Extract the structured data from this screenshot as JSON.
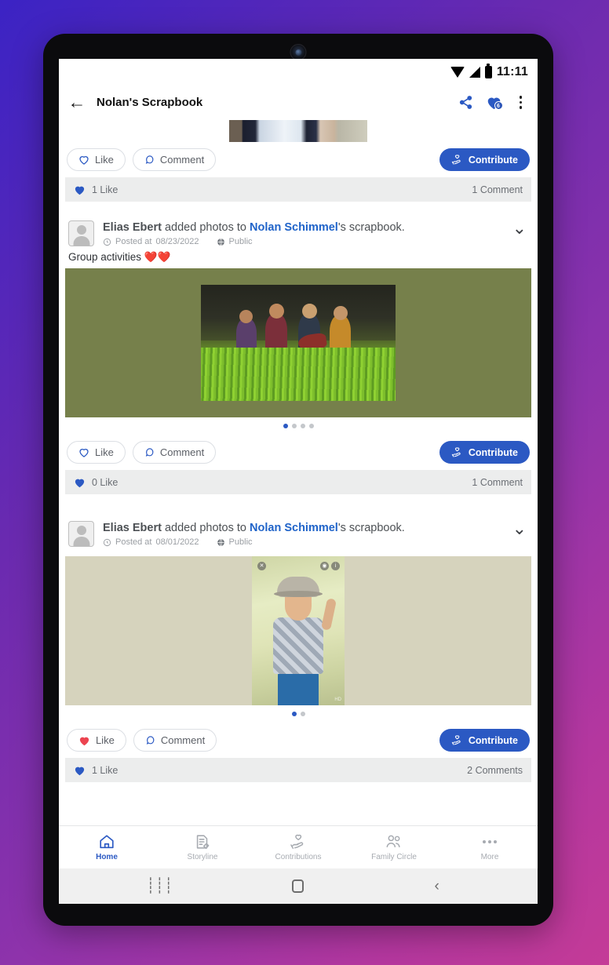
{
  "statusbar": {
    "time": "11:11",
    "icons": [
      "wifi-icon",
      "signal-icon",
      "battery-icon"
    ]
  },
  "appbar": {
    "back_icon": "back-arrow-icon",
    "title": "Nolan's Scrapbook",
    "share_icon": "share-icon",
    "favorites_icon": "heart-icon",
    "favorites_badge": "6",
    "overflow_icon": "more-vertical-icon"
  },
  "theme": {
    "accent": "#2b59c3",
    "link": "#1f63c9",
    "liked_heart": "#ec4450",
    "meta_bg": "#eceded",
    "text": "#4c5054"
  },
  "posts": [
    {
      "id": "post-top-partial",
      "like_label": "Like",
      "comment_label": "Comment",
      "contribute_label": "Contribute",
      "liked": false,
      "like_count": "1 Like",
      "comment_count": "1 Comment"
    },
    {
      "id": "post-group-activities",
      "actor": "Elias Ebert",
      "action": " added photos to ",
      "target": "Nolan Schimmel",
      "suffix": "'s scrapbook.",
      "posted_label": "Posted at",
      "date": "08/23/2022",
      "privacy": "Public",
      "caption": "Group activities ❤️❤️",
      "dots_total": 4,
      "dots_active": 0,
      "like_label": "Like",
      "comment_label": "Comment",
      "contribute_label": "Contribute",
      "liked": false,
      "like_count": "0 Like",
      "comment_count": "1 Comment"
    },
    {
      "id": "post-boy-hat",
      "actor": "Elias Ebert",
      "action": " added photos to ",
      "target": "Nolan Schimmel",
      "suffix": "'s scrapbook.",
      "posted_label": "Posted at",
      "date": "08/01/2022",
      "privacy": "Public",
      "caption": "",
      "dots_total": 2,
      "dots_active": 0,
      "like_label": "Like",
      "comment_label": "Comment",
      "contribute_label": "Contribute",
      "liked": true,
      "like_count": "1 Like",
      "comment_count": "2 Comments"
    }
  ],
  "bottom_nav": {
    "items": [
      {
        "label": "Home",
        "icon": "home-icon",
        "active": true
      },
      {
        "label": "Storyline",
        "icon": "note-edit-icon",
        "active": false
      },
      {
        "label": "Contributions",
        "icon": "heart-hand-icon",
        "active": false
      },
      {
        "label": "Family Circle",
        "icon": "people-icon",
        "active": false
      },
      {
        "label": "More",
        "icon": "more-horizontal-icon",
        "active": false
      }
    ]
  },
  "system_nav": {
    "recents_icon": "recents-icon",
    "home_icon": "home-square-icon",
    "back_icon": "back-chevron-icon"
  }
}
